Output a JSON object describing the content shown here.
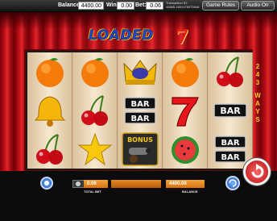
{
  "topbar": {
    "balance_label": "Balance:",
    "balance_value": "4400.00",
    "win_label": "Win:",
    "win_value": "0.00",
    "bet_label": "Bet:",
    "bet_value": "0.06",
    "transaction_label": "Transaction ID:",
    "transaction_id": "44865-1691476975948",
    "game_rules_label": "Game Rules",
    "audio_label": "Audio On"
  },
  "game": {
    "logo_text": "LOADED",
    "logo_seven": "7",
    "ways_left": [
      "2",
      "4",
      "3",
      "",
      "W",
      "A",
      "Y",
      "S"
    ],
    "ways_right": [
      "2",
      "4",
      "3",
      "",
      "W",
      "A",
      "Y",
      "S"
    ],
    "reels": [
      [
        "orange",
        "bell",
        "cherries"
      ],
      [
        "orange",
        "cherries",
        "star"
      ],
      [
        "crown",
        "double-bar",
        "bonus-cannon"
      ],
      [
        "orange",
        "seven",
        "watermelon"
      ],
      [
        "cherries",
        "bar",
        "double-bar"
      ]
    ],
    "symbol_text": {
      "bar": "BAR",
      "bonus": "BONUS"
    }
  },
  "bottombar": {
    "total_bet_value": "0.06",
    "total_bet_label": "TOTAL BET",
    "balance_value": "4400.00",
    "balance_label": "BALANCE"
  },
  "colors": {
    "curtain_red": "#c2101a",
    "ways_yellow": "#f4d21a",
    "field_orange": "#e88a22",
    "spin_red": "#d61c1c"
  }
}
